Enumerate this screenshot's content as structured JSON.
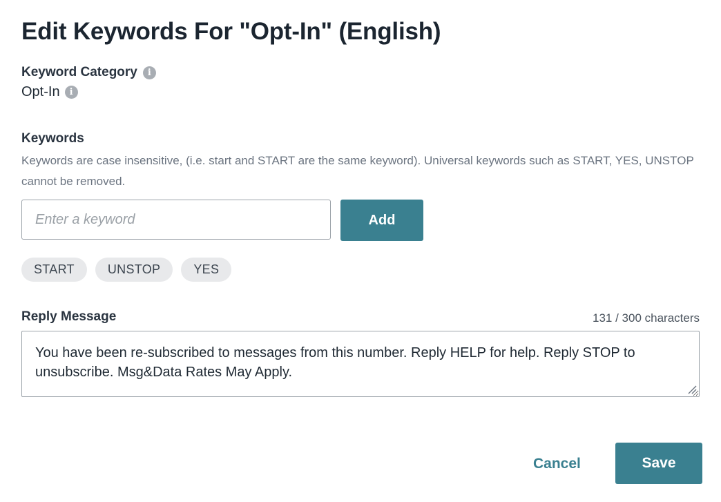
{
  "dialog": {
    "title": "Edit Keywords For \"Opt-In\" (English)"
  },
  "category": {
    "label": "Keyword Category",
    "value": "Opt-In"
  },
  "keywords": {
    "label": "Keywords",
    "help_text": "Keywords are case insensitive, (i.e. start and START are the same keyword). Universal keywords such as START, YES, UNSTOP cannot be removed.",
    "input_placeholder": "Enter a keyword",
    "input_value": "",
    "add_label": "Add",
    "chips": [
      "START",
      "UNSTOP",
      "YES"
    ]
  },
  "reply": {
    "label": "Reply Message",
    "char_count": "131 / 300 characters",
    "message": "You have been re-subscribed to messages from this number. Reply HELP for help. Reply STOP to unsubscribe. Msg&Data Rates May Apply."
  },
  "actions": {
    "cancel_label": "Cancel",
    "save_label": "Save"
  },
  "icons": {
    "info": "info-icon",
    "resize": "resize-grip-icon"
  },
  "colors": {
    "accent": "#3a8090",
    "chip_bg": "#e8e9eb",
    "info_icon": "#a8adb3"
  }
}
